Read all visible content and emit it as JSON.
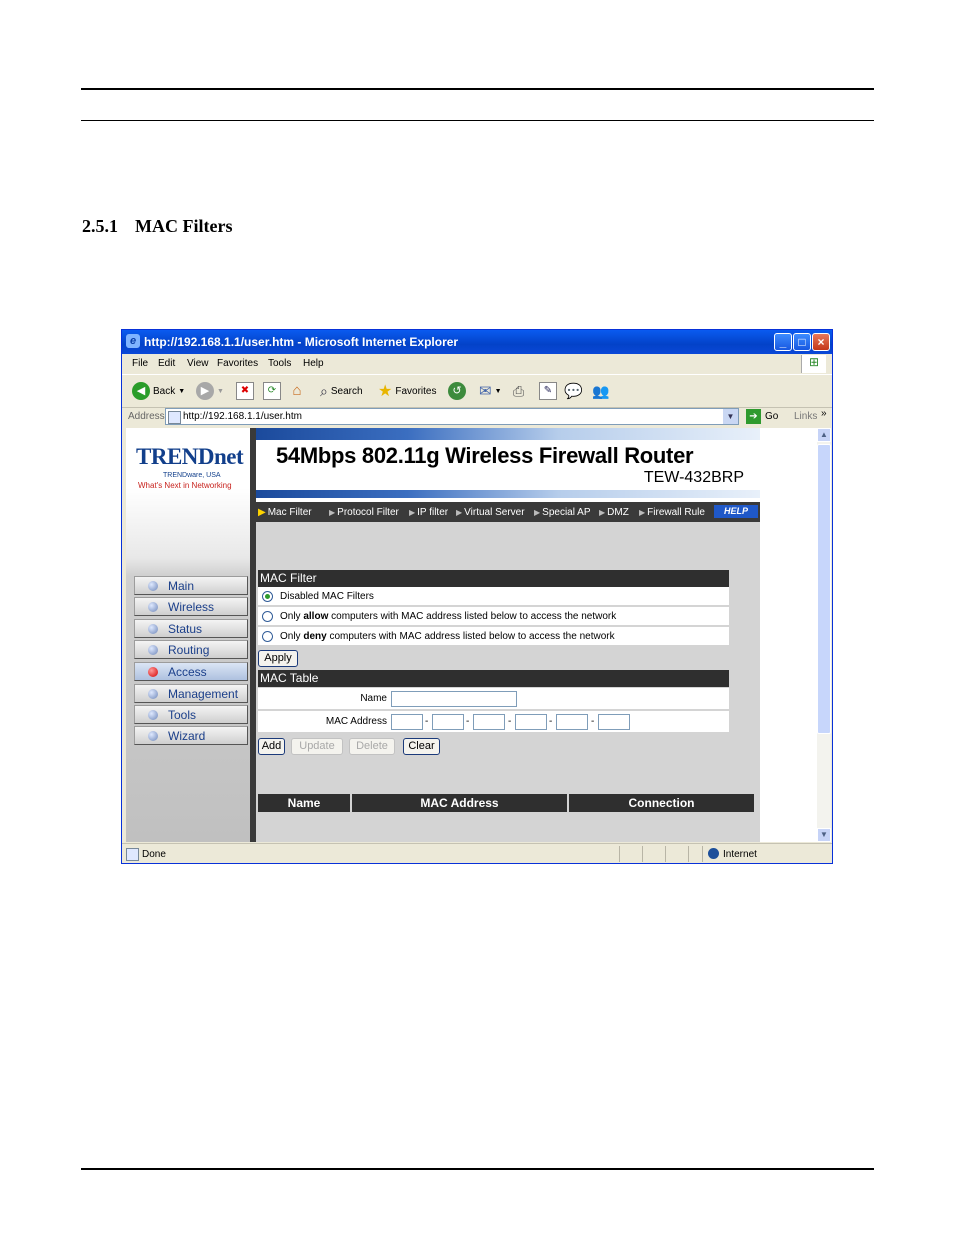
{
  "section": {
    "number": "2.5.1",
    "title": "MAC Filters"
  },
  "browser": {
    "title": "http://192.168.1.1/user.htm - Microsoft Internet Explorer",
    "window_buttons": [
      "_",
      "□",
      "×"
    ],
    "menu": [
      "File",
      "Edit",
      "View",
      "Favorites",
      "Tools",
      "Help"
    ],
    "toolbar": {
      "back": "Back",
      "search": "Search",
      "favorites": "Favorites"
    },
    "address_label": "Address",
    "address": "http://192.168.1.1/user.htm",
    "go": "Go",
    "links": "Links",
    "status": "Done",
    "zone": "Internet"
  },
  "router": {
    "logo": "TRENDnet",
    "logo_sub1": "TRENDware, USA",
    "logo_sub2": "What's Next in Networking",
    "banner_title": "54Mbps 802.11g Wireless Firewall Router",
    "model": "TEW-432BRP",
    "nav": [
      {
        "label": "Main",
        "active": false
      },
      {
        "label": "Wireless",
        "active": false
      },
      {
        "label": "Status",
        "active": false
      },
      {
        "label": "Routing",
        "active": false
      },
      {
        "label": "Access",
        "active": true
      },
      {
        "label": "Management",
        "active": false
      },
      {
        "label": "Tools",
        "active": false
      },
      {
        "label": "Wizard",
        "active": false
      }
    ],
    "subnav": [
      "Mac Filter",
      "Protocol Filter",
      "IP filter",
      "Virtual Server",
      "Special AP",
      "DMZ",
      "Firewall Rule"
    ],
    "help": "HELP",
    "mac_filter": {
      "heading": "MAC Filter",
      "opt_disabled": "Disabled MAC Filters",
      "opt_allow_pre": "Only ",
      "opt_allow_bold": "allow",
      "opt_allow_post": " computers with MAC address listed below to access the network",
      "opt_deny_pre": "Only ",
      "opt_deny_bold": "deny",
      "opt_deny_post": " computers with MAC address listed below to access the network",
      "selected": "disabled",
      "apply": "Apply"
    },
    "mac_table": {
      "heading": "MAC Table",
      "name_label": "Name",
      "name_value": "",
      "mac_label": "MAC Address",
      "mac_values": [
        "",
        "",
        "",
        "",
        "",
        ""
      ],
      "separator": "-",
      "buttons": {
        "add": "Add",
        "update": "Update",
        "delete": "Delete",
        "clear": "Clear"
      },
      "columns": [
        "Name",
        "MAC Address",
        "Connection"
      ]
    }
  }
}
